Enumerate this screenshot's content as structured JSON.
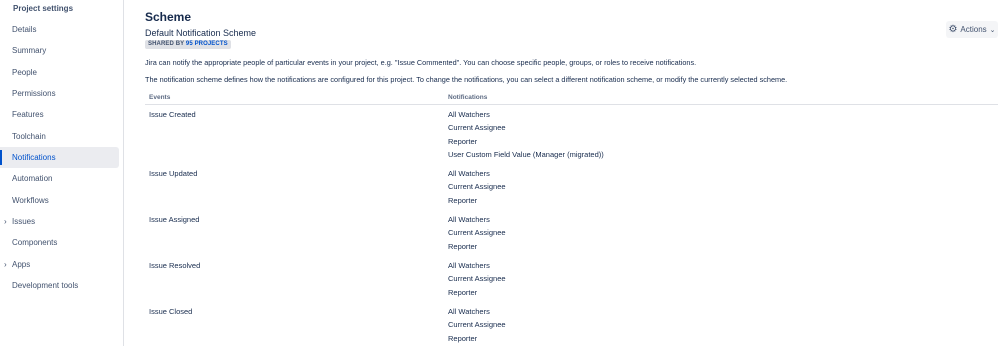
{
  "sidebar": {
    "title": "Project settings",
    "items": [
      {
        "label": "Details"
      },
      {
        "label": "Summary"
      },
      {
        "label": "People"
      },
      {
        "label": "Permissions"
      },
      {
        "label": "Features"
      },
      {
        "label": "Toolchain"
      },
      {
        "label": "Notifications",
        "active": true
      },
      {
        "label": "Automation"
      },
      {
        "label": "Workflows"
      },
      {
        "label": "Issues",
        "expandable": true
      },
      {
        "label": "Components"
      },
      {
        "label": "Apps",
        "expandable": true
      },
      {
        "label": "Development tools"
      }
    ]
  },
  "header": {
    "title": "Scheme",
    "scheme_name": "Default Notification Scheme",
    "shared_prefix": "SHARED BY",
    "shared_count": "95 PROJECTS",
    "actions_label": "Actions",
    "actions_icon": "gear-icon"
  },
  "description": {
    "line1": "Jira can notify the appropriate people of particular events in your project, e.g. \"Issue Commented\". You can choose specific people, groups, or roles to receive notifications.",
    "line2": "The notification scheme defines how the notifications are configured for this project. To change the notifications, you can select a different notification scheme, or modify the currently selected scheme."
  },
  "table": {
    "columns": {
      "events": "Events",
      "notifications": "Notifications"
    },
    "rows": [
      {
        "event": "Issue Created",
        "notifications": [
          "All Watchers",
          "Current Assignee",
          "Reporter",
          "User Custom Field Value (Manager (migrated))"
        ]
      },
      {
        "event": "Issue Updated",
        "notifications": [
          "All Watchers",
          "Current Assignee",
          "Reporter"
        ]
      },
      {
        "event": "Issue Assigned",
        "notifications": [
          "All Watchers",
          "Current Assignee",
          "Reporter"
        ]
      },
      {
        "event": "Issue Resolved",
        "notifications": [
          "All Watchers",
          "Current Assignee",
          "Reporter"
        ]
      },
      {
        "event": "Issue Closed",
        "notifications": [
          "All Watchers",
          "Current Assignee",
          "Reporter"
        ]
      }
    ]
  },
  "colors": {
    "accent": "#0052cc",
    "active_bg": "#ebecf0",
    "text": "#172b4d"
  }
}
